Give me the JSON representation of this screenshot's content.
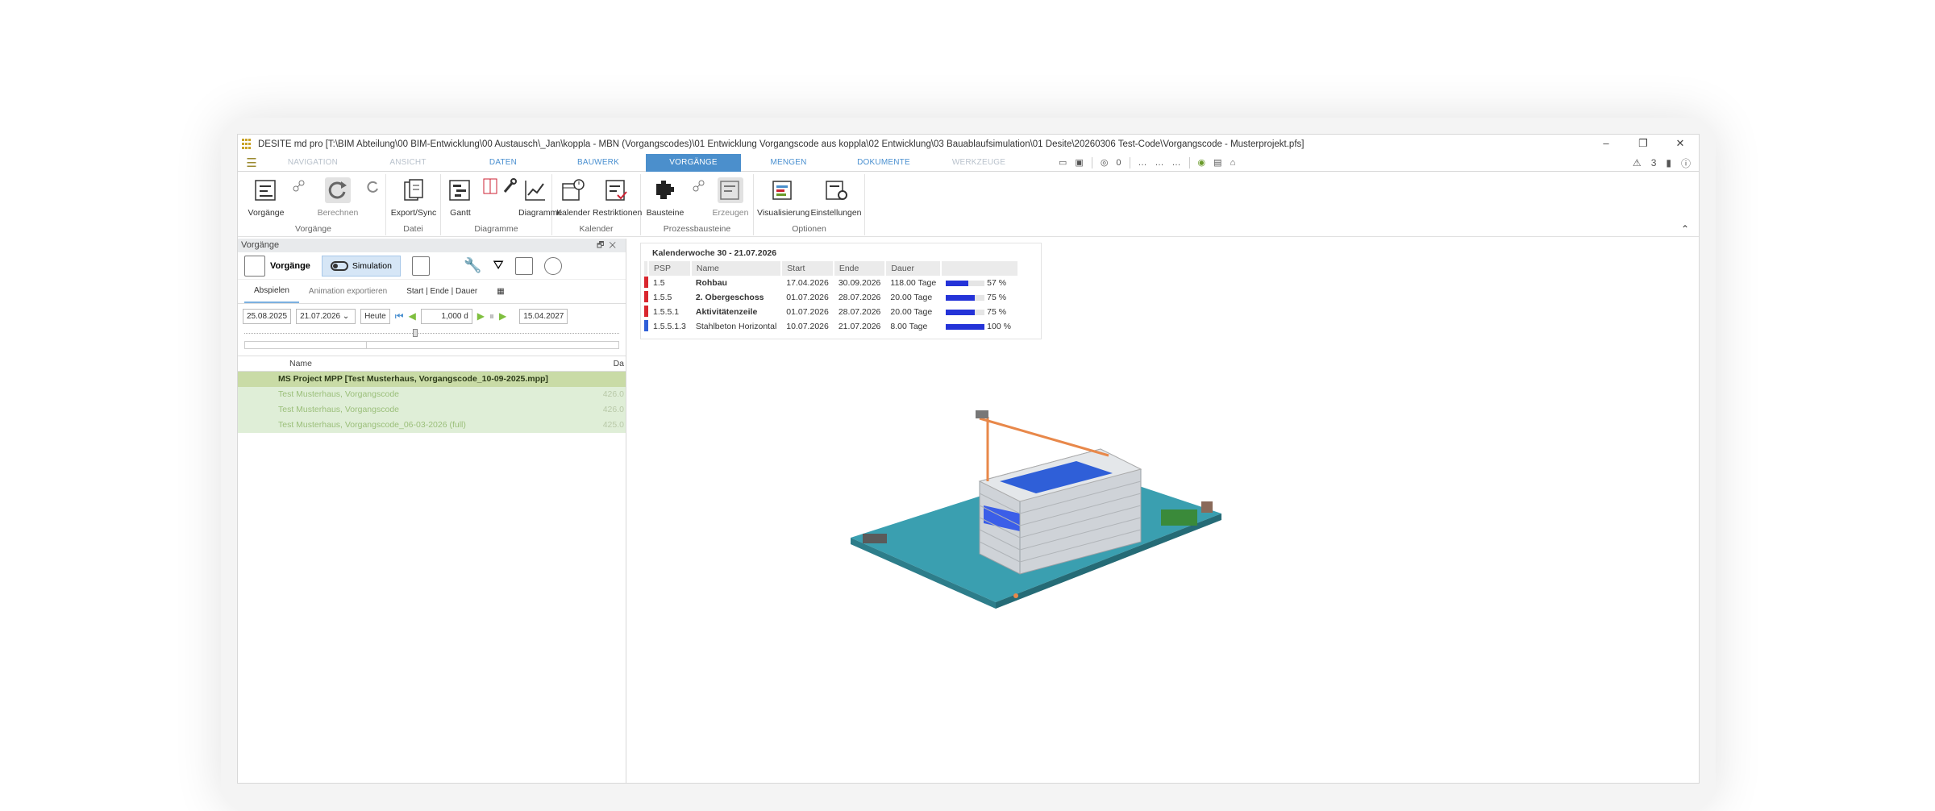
{
  "window": {
    "title": "DESITE md pro [T:\\BIM Abteilung\\00 BIM-Entwicklung\\00 Austausch\\_Jan\\koppla - MBN (Vorgangscodes)\\01 Entwicklung Vorgangscode aus koppla\\02 Entwicklung\\03 Bauablaufsimulation\\01 Desite\\20260306 Test-Code\\Vorgangscode - Musterprojekt.pfs]",
    "controls": [
      "–",
      "❐",
      "✕"
    ]
  },
  "tabs": [
    {
      "label": "NAVIGATION",
      "state": "dim"
    },
    {
      "label": "ANSICHT",
      "state": "dim"
    },
    {
      "label": "DATEN",
      "state": "normal"
    },
    {
      "label": "BAUWERK",
      "state": "normal"
    },
    {
      "label": "VORGÄNGE",
      "state": "active"
    },
    {
      "label": "MENGEN",
      "state": "normal"
    },
    {
      "label": "DOKUMENTE",
      "state": "normal"
    },
    {
      "label": "WERKZEUGE",
      "state": "dim"
    }
  ],
  "quick_access": {
    "visibility_count": "0",
    "warnings": "3"
  },
  "ribbon": {
    "groups": [
      {
        "label": "Vorgänge",
        "buttons": [
          "Vorgänge",
          "Berechnen"
        ]
      },
      {
        "label": "Datei",
        "buttons": [
          "Export/Sync"
        ]
      },
      {
        "label": "Diagramme",
        "buttons": [
          "Gantt",
          "Diagramme"
        ]
      },
      {
        "label": "Kalender",
        "buttons": [
          "Kalender",
          "Restriktionen"
        ]
      },
      {
        "label": "Prozessbausteine",
        "buttons": [
          "Bausteine",
          "Erzeugen"
        ]
      },
      {
        "label": "Optionen",
        "buttons": [
          "Visualisierung",
          "Einstellungen"
        ]
      }
    ]
  },
  "panel": {
    "title": "Vorgänge",
    "toolbar": {
      "vorgaenge": "Vorgänge",
      "simulation": "Simulation"
    },
    "tabs": [
      "Abspielen",
      "Animation exportieren",
      "Start | Ende | Dauer"
    ],
    "playback": {
      "start_date": "25.08.2025",
      "current_date": "21.07.2026",
      "today": "Heute",
      "step": "1,000 d",
      "end_date": "15.04.2027",
      "position": 0.45
    },
    "tree": {
      "columns": [
        "Name",
        "Da"
      ],
      "rows": [
        {
          "name": "MS Project MPP [Test Musterhaus, Vorgangscode_10-09-2025.mpp]",
          "dur": "",
          "root": true
        },
        {
          "name": "Test Musterhaus, Vorgangscode",
          "dur": "426.0",
          "root": false
        },
        {
          "name": "Test Musterhaus, Vorgangscode",
          "dur": "426.0",
          "root": false
        },
        {
          "name": "Test Musterhaus, Vorgangscode_06-03-2026 (full)",
          "dur": "425.0",
          "root": false
        }
      ]
    }
  },
  "calendar_week": {
    "title": "Kalenderwoche 30 - 21.07.2026",
    "columns": [
      "PSP",
      "Name",
      "Start",
      "Ende",
      "Dauer"
    ],
    "rows": [
      {
        "psp": "1.5",
        "name": "Rohbau",
        "start": "17.04.2026",
        "end": "30.09.2026",
        "duration": "118.00 Tage",
        "percent": "57 %",
        "progress": 0.57,
        "color": "#d9262e",
        "bold": true
      },
      {
        "psp": "1.5.5",
        "name": "2. Obergeschoss",
        "start": "01.07.2026",
        "end": "28.07.2026",
        "duration": "20.00 Tage",
        "percent": "75 %",
        "progress": 0.75,
        "color": "#d9262e",
        "bold": true
      },
      {
        "psp": "1.5.5.1",
        "name": "Aktivitätenzeile",
        "start": "01.07.2026",
        "end": "28.07.2026",
        "duration": "20.00 Tage",
        "percent": "75 %",
        "progress": 0.75,
        "color": "#d9262e",
        "bold": true
      },
      {
        "psp": "1.5.5.1.3",
        "name": "Stahlbeton Horizontal",
        "start": "10.07.2026",
        "end": "21.07.2026",
        "duration": "8.00 Tage",
        "percent": "100 %",
        "progress": 1.0,
        "color": "#2f5fd8",
        "bold": false
      }
    ]
  },
  "colors": {
    "accent": "#4b8fcc",
    "tree_green": "#dfeed7",
    "tree_root": "#c9dba6",
    "progress": "#2433d8"
  }
}
